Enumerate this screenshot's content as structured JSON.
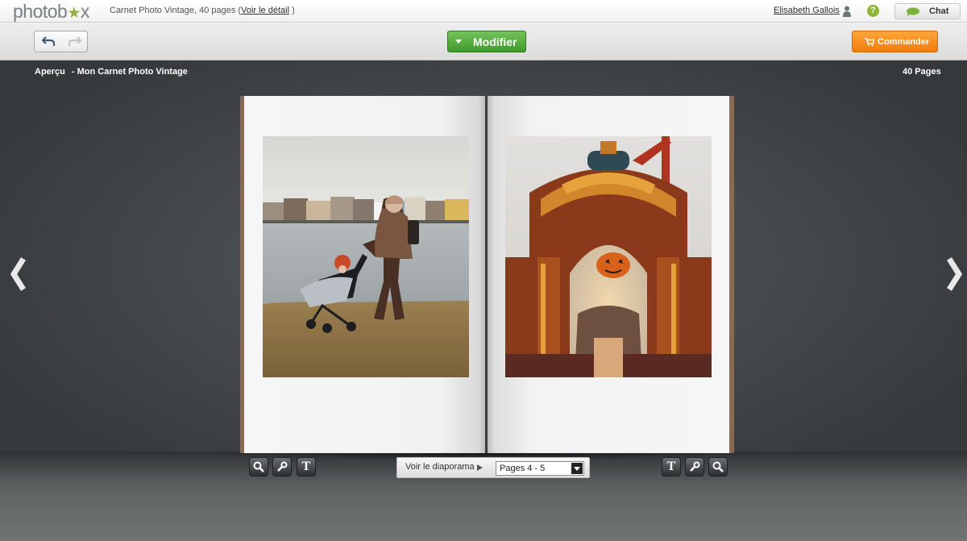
{
  "header": {
    "logo_text_start": "photob",
    "logo_star": "★",
    "logo_text_end": "x",
    "product_info": "Carnet Photo Vintage, 40 pages",
    "detail_open": "(",
    "detail_link": "Voir le détail",
    "detail_close": ")",
    "user_name": "Elisabeth Gallois",
    "help_label": "?",
    "chat_label": "Chat"
  },
  "toolbar": {
    "undo_icon": "undo-arrow-icon",
    "redo_icon": "redo-arrow-icon",
    "modifier_label": "Modifier",
    "commander_label": "Commander"
  },
  "preview": {
    "breadcrumb_label": "Aperçu",
    "breadcrumb_title": "- Mon Carnet Photo Vintage",
    "page_count": "40 Pages",
    "prev_icon": "chevron-left-icon",
    "next_icon": "chevron-right-icon"
  },
  "bottom": {
    "left_tools": [
      "zoom-icon",
      "wrench-icon",
      "text-icon"
    ],
    "right_tools": [
      "text-icon",
      "wrench-icon",
      "zoom-icon"
    ],
    "text_tool_glyph": "T",
    "slideshow_label": "Voir le diaporama",
    "pages_selected": "Pages 4 - 5"
  },
  "colors": {
    "modifier_green": "#4aa535",
    "commander_orange": "#f58a1c",
    "logo_star_green": "#8fb43a"
  }
}
